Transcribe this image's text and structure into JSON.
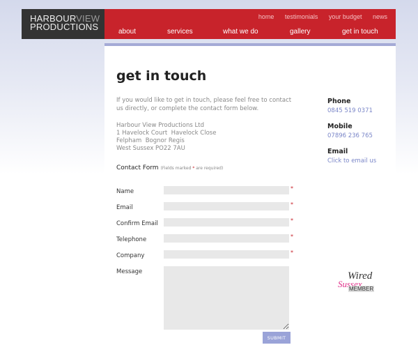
{
  "logo": {
    "line1_a": "HARBOUR",
    "line1_b": "VIEW",
    "line2": "PRODUCTIONS"
  },
  "top_nav": [
    "home",
    "testimonials",
    "your budget",
    "news"
  ],
  "main_nav": [
    "about",
    "services",
    "what we do",
    "gallery",
    "get in touch"
  ],
  "page_title": "get in touch",
  "intro": "If you would like to get in touch, please feel free to contact us directly, or complete the contact form below.",
  "address": [
    "Harbour View Productions Ltd",
    "1 Havelock Court  Havelock Close",
    "Felpham  Bognor Regis",
    "West Sussex PO22 7AU"
  ],
  "contact": {
    "phone_label": "Phone",
    "phone": "0845 519 0371",
    "mobile_label": "Mobile",
    "mobile": "07896 236 765",
    "email_label": "Email",
    "email_link": "Click to email us"
  },
  "form": {
    "title": "Contact Form",
    "note_a": "(Fields marked ",
    "note_star": "*",
    "note_b": " are required)",
    "fields": [
      {
        "label": "Name",
        "required": "*"
      },
      {
        "label": "Email",
        "required": "*"
      },
      {
        "label": "Confirm Email",
        "required": "*"
      },
      {
        "label": "Telephone",
        "required": "*"
      },
      {
        "label": "Company",
        "required": "*"
      },
      {
        "label": "Message",
        "required": ""
      }
    ],
    "submit": "SUBMIT"
  },
  "badge": {
    "wired": "Wired",
    "sussex": "Sussex",
    "member": "MEMBER"
  },
  "colors": {
    "brand_red": "#c8232b",
    "accent_blue": "#9aa3d8",
    "logo_bg": "#333333"
  }
}
